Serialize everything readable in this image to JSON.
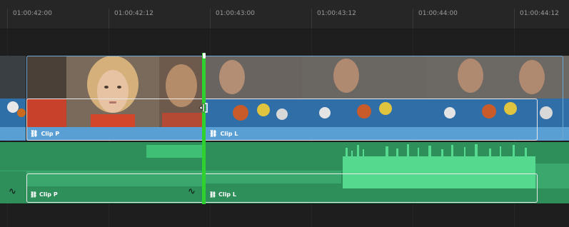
{
  "ruler": {
    "timecodes": [
      "01:00:42:00",
      "01:00:42:12",
      "01:00:43:00",
      "01:00:43:12",
      "01:00:44:00",
      "01:00:44:12"
    ]
  },
  "video_track": {
    "clips": [
      {
        "name": "Clip P",
        "link_icon": "link-icon"
      },
      {
        "name": "Clip L",
        "link_icon": "link-icon"
      }
    ]
  },
  "audio_track": {
    "clips": [
      {
        "name": "Clip P",
        "link_icon": "link-icon"
      },
      {
        "name": "Clip L",
        "link_icon": "link-icon"
      }
    ]
  },
  "colors": {
    "playhead": "#2ed12e",
    "video_clip_bar": "#5a9fd4",
    "audio_track": "#2e8f5a",
    "waveform": "#55d98f",
    "selection": "#e8e8e8"
  }
}
